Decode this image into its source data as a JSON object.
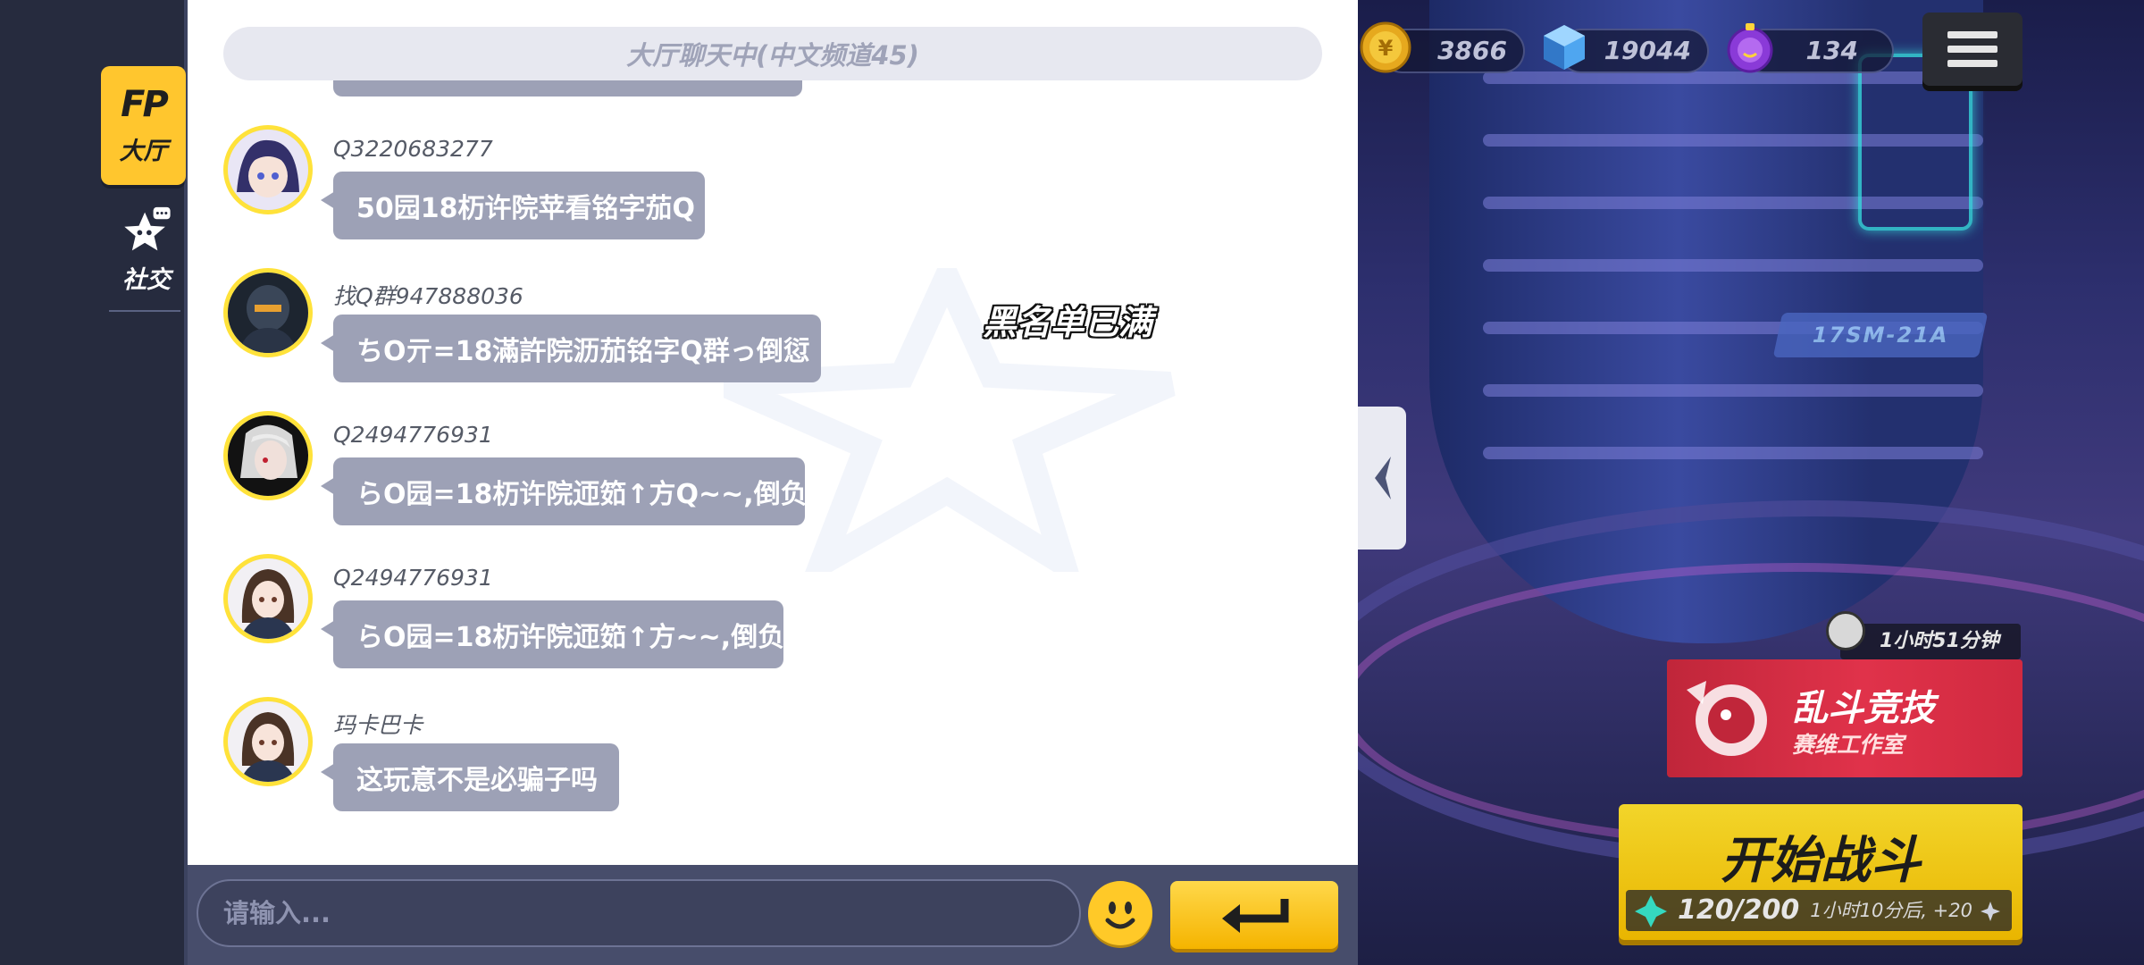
{
  "sidebar": {
    "lobby": {
      "logo": "FP",
      "label": "大厅"
    },
    "social": {
      "label": "社交"
    }
  },
  "chat": {
    "channel_title": "大厅聊天中(中文频道45)",
    "messages": [
      {
        "username": "Q3220683277",
        "text": "50园18杤许院苹看铭字茄Q"
      },
      {
        "username": "找Q群947888036",
        "text": "ちO亓=18滿許院沥茄铭字Q群っ倒愆"
      },
      {
        "username": "Q2494776931",
        "text": "らO园=18杤许院迊筎↑方Q~~,倒负"
      },
      {
        "username": "Q2494776931",
        "text": "らO园=18杤许院迊筎↑方~~,倒负"
      },
      {
        "username": "玛卡巴卡",
        "text": "这玩意不是必骗子吗"
      }
    ],
    "toast": "黑名单已满",
    "input_placeholder": "请输入..."
  },
  "currency": {
    "gold": "3866",
    "gems": "19044",
    "tokens": "134"
  },
  "event": {
    "timer": "1小时51分钟",
    "mode_title": "乱斗竞技",
    "mode_subtitle": "赛维工作室"
  },
  "start": {
    "label": "开始战斗",
    "stamina": "120/200",
    "regen": "1小时10分后, +20"
  },
  "colors": {
    "accent_yellow": "#ffc62e",
    "bubble": "#9da1b6",
    "rail": "#262b3e",
    "input_bar": "#474d6b"
  },
  "icons": [
    "fp-logo-icon",
    "star-chat-icon",
    "gold-coin-icon",
    "gem-cube-icon",
    "token-icon",
    "menu-icon",
    "collapse-arrow-icon",
    "emoji-icon",
    "enter-icon",
    "stopwatch-icon",
    "stamina-gem-icon"
  ]
}
